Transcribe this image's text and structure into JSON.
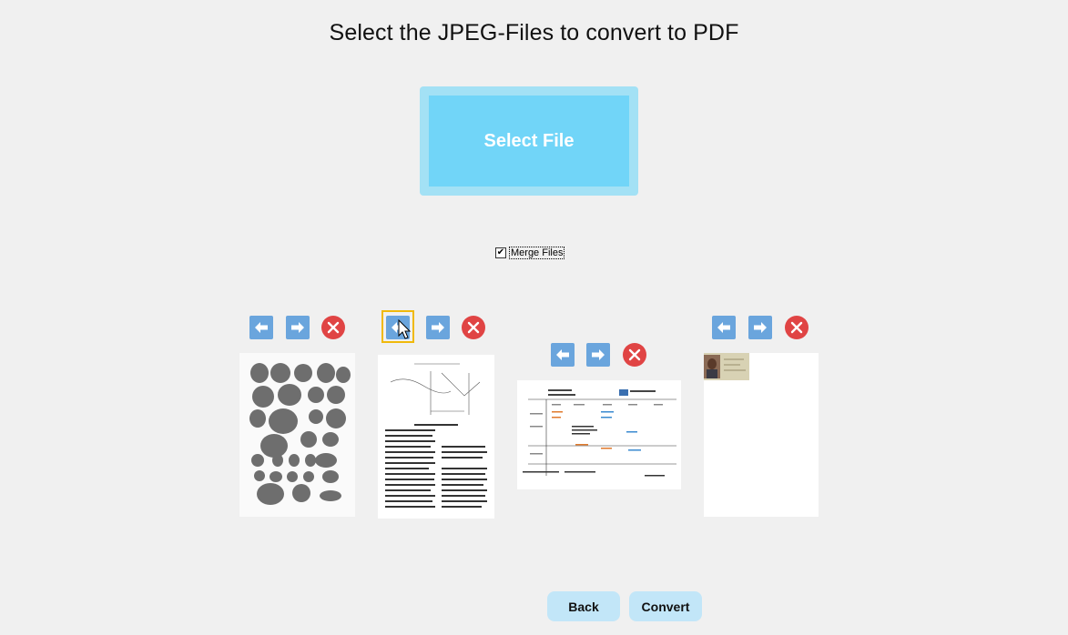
{
  "page": {
    "title": "Select the JPEG-Files to convert to PDF"
  },
  "select_button": {
    "label": "Select File"
  },
  "merge": {
    "label": "Merge Files",
    "checked": true,
    "check_glyph": "✔"
  },
  "files": [
    {
      "name": "fossil-plate",
      "kind": "portrait"
    },
    {
      "name": "article-page",
      "kind": "portrait"
    },
    {
      "name": "table-sheet",
      "kind": "landscape"
    },
    {
      "name": "id-card-page",
      "kind": "portrait"
    }
  ],
  "icons": {
    "left": "left-arrow-icon",
    "right": "right-arrow-icon",
    "remove": "close-icon"
  },
  "colors": {
    "accent": "#71d5f8",
    "arrow": "#6aa5dd",
    "remove": "#e04444",
    "focus": "#f0b90b"
  },
  "footer": {
    "back_label": "Back",
    "convert_label": "Convert"
  }
}
